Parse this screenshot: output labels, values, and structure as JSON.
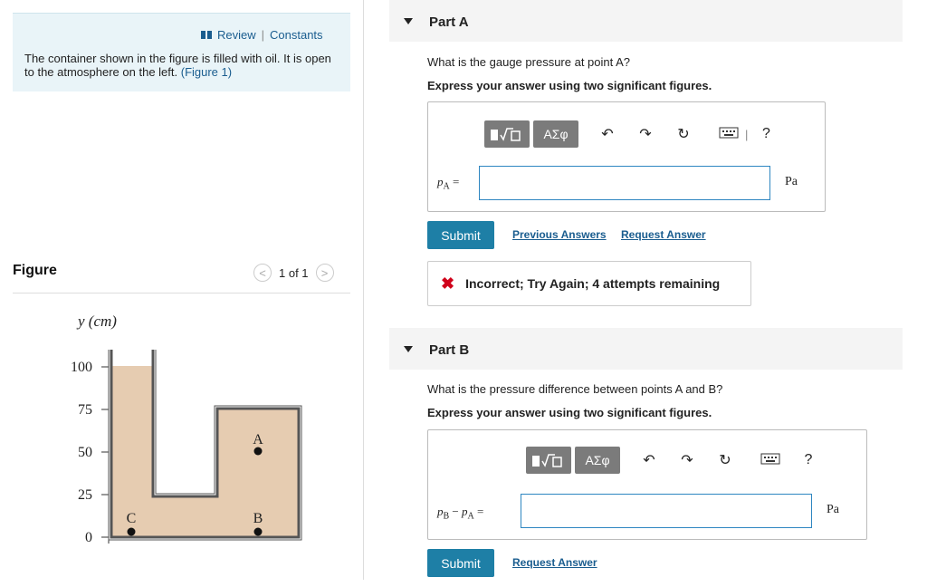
{
  "intro": {
    "review_label": "Review",
    "separator": "|",
    "constants_label": "Constants",
    "text": "The container shown in the figure is filled with oil. It is open to the atmosphere on the left.",
    "figure_link": "(Figure 1)"
  },
  "figure": {
    "heading": "Figure",
    "pager": "1 of 1",
    "prev": "<",
    "next": ">",
    "y_axis_label": "y (cm)",
    "ticks": [
      "100",
      "75",
      "50",
      "25",
      "0"
    ],
    "point_labels": {
      "A": "A",
      "B": "B",
      "C": "C"
    }
  },
  "partA": {
    "title": "Part A",
    "question": "What is the gauge pressure at point A?",
    "instruction": "Express your answer using two significant figures.",
    "var_p": "p",
    "var_sub": "A",
    "equals": "=",
    "unit": "Pa",
    "input_value": "",
    "tool_symbols": "ΑΣφ",
    "tool_help": "?",
    "submit": "Submit",
    "previous_answers": "Previous Answers",
    "request_answer": "Request Answer",
    "feedback": "Incorrect; Try Again; 4 attempts remaining",
    "feedback_icon": "✖"
  },
  "partB": {
    "title": "Part B",
    "question": "What is the pressure difference between points A and B?",
    "instruction": "Express your answer using two significant figures.",
    "var_p1": "p",
    "var_sub1": "B",
    "minus": "−",
    "var_p2": "p",
    "var_sub2": "A",
    "equals": "=",
    "unit": "Pa",
    "input_value": "",
    "tool_symbols": "ΑΣφ",
    "tool_help": "?",
    "submit": "Submit",
    "request_answer": "Request Answer"
  },
  "colors": {
    "oil": "#e6ccb1",
    "accent": "#1e7fa6",
    "link": "#1a5d8f",
    "error": "#d0021b"
  }
}
